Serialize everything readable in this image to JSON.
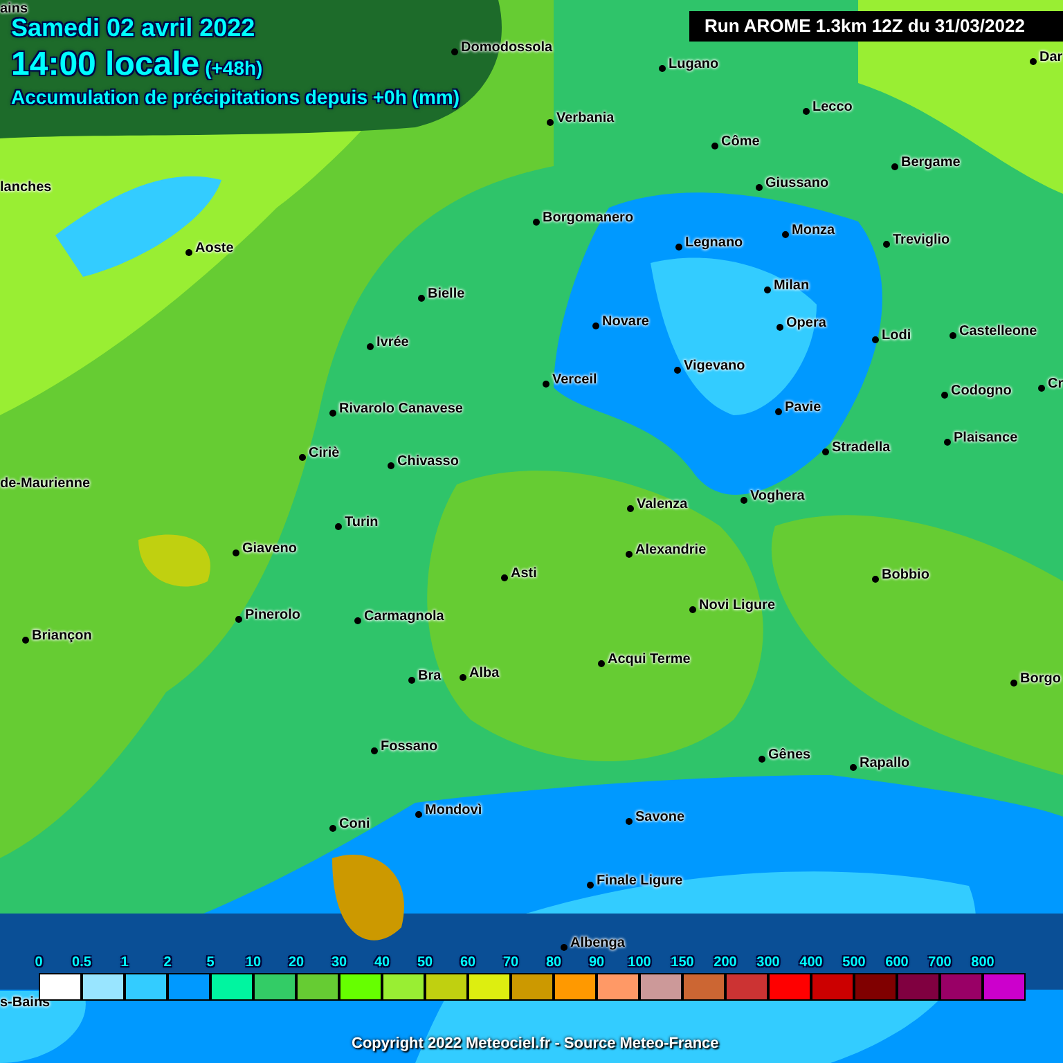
{
  "header": {
    "date": "Samedi 02 avril 2022",
    "time": "14:00 locale",
    "lead": "(+48h)",
    "subtitle": "Accumulation de précipitations depuis +0h (mm)"
  },
  "run_label": "Run AROME 1.3km 12Z du 31/03/2022",
  "cities": [
    {
      "name": "ains"
    },
    {
      "name": "Domodossola"
    },
    {
      "name": "Lugano"
    },
    {
      "name": "Dar"
    },
    {
      "name": "Verbania"
    },
    {
      "name": "Lecco"
    },
    {
      "name": "Côme"
    },
    {
      "name": "Giussano"
    },
    {
      "name": "Bergame"
    },
    {
      "name": "lanches"
    },
    {
      "name": "Aoste"
    },
    {
      "name": "Borgomanero"
    },
    {
      "name": "Legnano"
    },
    {
      "name": "Monza"
    },
    {
      "name": "Treviglio"
    },
    {
      "name": "Bielle"
    },
    {
      "name": "Milan"
    },
    {
      "name": "Novare"
    },
    {
      "name": "Opera"
    },
    {
      "name": "Lodi"
    },
    {
      "name": "Castelleone"
    },
    {
      "name": "Ivrée"
    },
    {
      "name": "Vigevano"
    },
    {
      "name": "Verceil"
    },
    {
      "name": "Codogno"
    },
    {
      "name": "Cr"
    },
    {
      "name": "Rivarolo Canavese"
    },
    {
      "name": "Pavie"
    },
    {
      "name": "Stradella"
    },
    {
      "name": "Plaisance"
    },
    {
      "name": "Ciriè"
    },
    {
      "name": "Chivasso"
    },
    {
      "name": "de-Maurienne"
    },
    {
      "name": "Valenza"
    },
    {
      "name": "Voghera"
    },
    {
      "name": "Turin"
    },
    {
      "name": "Giaveno"
    },
    {
      "name": "Alexandrie"
    },
    {
      "name": "Asti"
    },
    {
      "name": "Bobbio"
    },
    {
      "name": "Pinerolo"
    },
    {
      "name": "Carmagnola"
    },
    {
      "name": "Novi Ligure"
    },
    {
      "name": "Briançon"
    },
    {
      "name": "Acqui Terme"
    },
    {
      "name": "Bra"
    },
    {
      "name": "Alba"
    },
    {
      "name": "Borgo"
    },
    {
      "name": "Fossano"
    },
    {
      "name": "Gênes"
    },
    {
      "name": "Rapallo"
    },
    {
      "name": "Mondovì"
    },
    {
      "name": "Coni"
    },
    {
      "name": "Savone"
    },
    {
      "name": "Finale Ligure"
    },
    {
      "name": "Albenga"
    },
    {
      "name": "s-Bains"
    }
  ],
  "legend": [
    {
      "label": "0",
      "color": "#ffffff"
    },
    {
      "label": "0.5",
      "color": "#99e5ff"
    },
    {
      "label": "1",
      "color": "#33ccff"
    },
    {
      "label": "2",
      "color": "#0099ff"
    },
    {
      "label": "5",
      "color": "#00f5a0"
    },
    {
      "label": "10",
      "color": "#33cc66"
    },
    {
      "label": "20",
      "color": "#66cc33"
    },
    {
      "label": "30",
      "color": "#66ff00"
    },
    {
      "label": "40",
      "color": "#99ee33"
    },
    {
      "label": "50",
      "color": "#c0d010"
    },
    {
      "label": "60",
      "color": "#ddee10"
    },
    {
      "label": "70",
      "color": "#cc9900"
    },
    {
      "label": "80",
      "color": "#ff9900"
    },
    {
      "label": "90",
      "color": "#ff9966"
    },
    {
      "label": "100",
      "color": "#cc9999"
    },
    {
      "label": "150",
      "color": "#cc6633"
    },
    {
      "label": "200",
      "color": "#cc3333"
    },
    {
      "label": "300",
      "color": "#ff0000"
    },
    {
      "label": "400",
      "color": "#cc0000"
    },
    {
      "label": "500",
      "color": "#800000"
    },
    {
      "label": "600",
      "color": "#800040"
    },
    {
      "label": "700",
      "color": "#990066"
    },
    {
      "label": "800",
      "color": "#cc00cc"
    }
  ],
  "copyright": "Copyright 2022 Meteociel.fr - Source Meteo-France"
}
